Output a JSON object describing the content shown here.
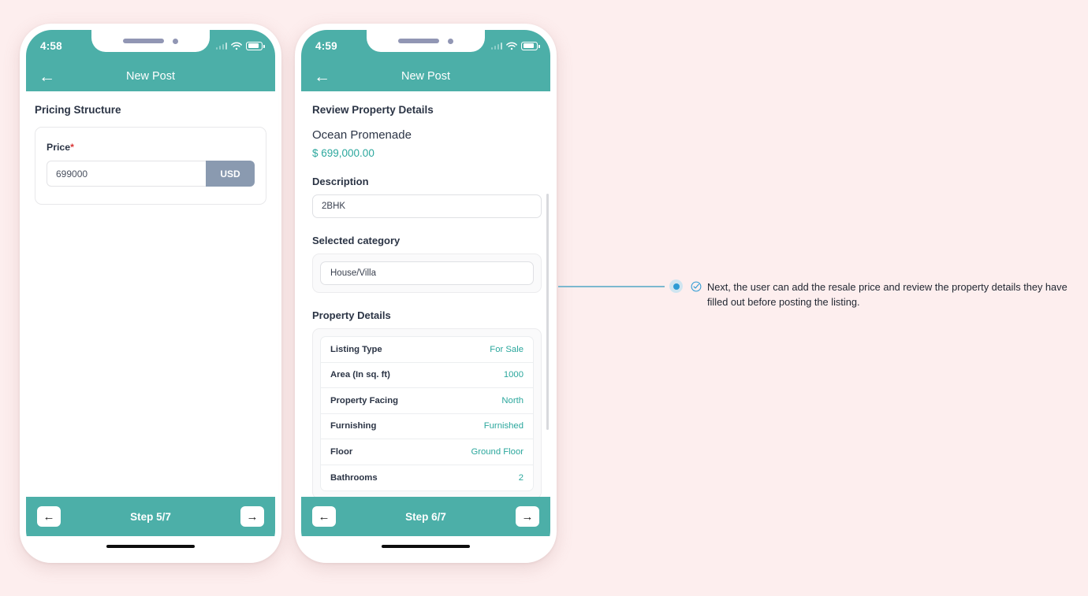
{
  "background_color": "#FDEEEE",
  "accent_teal": "#4CAFA8",
  "value_teal": "#2BA79D",
  "required_red": "#D93636",
  "usd_button_color": "#8A9AB0",
  "annotation_blue": "#2D9BD4",
  "phone1": {
    "status": {
      "time": "4:58",
      "signal_icon": "signal-bars-icon",
      "wifi_icon": "wifi-icon",
      "battery_icon": "battery-icon"
    },
    "appbar": {
      "back_icon": "back-arrow-icon",
      "title": "New Post"
    },
    "section_title": "Pricing Structure",
    "price_field": {
      "label": "Price",
      "required_marker": "*",
      "value": "699000",
      "placeholder": "Price",
      "currency_button": "USD"
    },
    "stepbar": {
      "prev_icon": "arrow-left-icon",
      "label": "Step 5/7",
      "next_icon": "arrow-right-icon"
    }
  },
  "phone2": {
    "status": {
      "time": "4:59",
      "signal_icon": "signal-bars-icon",
      "wifi_icon": "wifi-icon",
      "battery_icon": "battery-icon"
    },
    "appbar": {
      "back_icon": "back-arrow-icon",
      "title": "New Post"
    },
    "section_title": "Review Property Details",
    "property_name": "Ocean Promenade",
    "property_price": "$ 699,000.00",
    "description_label": "Description",
    "description_value": "2BHK",
    "category_label": "Selected category",
    "category_value": "House/Villa",
    "details_label": "Property Details",
    "details_rows": [
      {
        "key": "Listing Type",
        "value": "For Sale"
      },
      {
        "key": "Area (In sq. ft)",
        "value": "1000"
      },
      {
        "key": "Property Facing",
        "value": "North"
      },
      {
        "key": "Furnishing",
        "value": "Furnished"
      },
      {
        "key": "Floor",
        "value": "Ground Floor"
      },
      {
        "key": "Bathrooms",
        "value": "2"
      }
    ],
    "stepbar": {
      "prev_icon": "arrow-left-icon",
      "label": "Step 6/7",
      "next_icon": "arrow-right-icon"
    }
  },
  "annotation": {
    "check_icon": "check-circle-icon",
    "text": "Next, the user can add the resale price and review the property details they have filled out before posting the listing."
  }
}
